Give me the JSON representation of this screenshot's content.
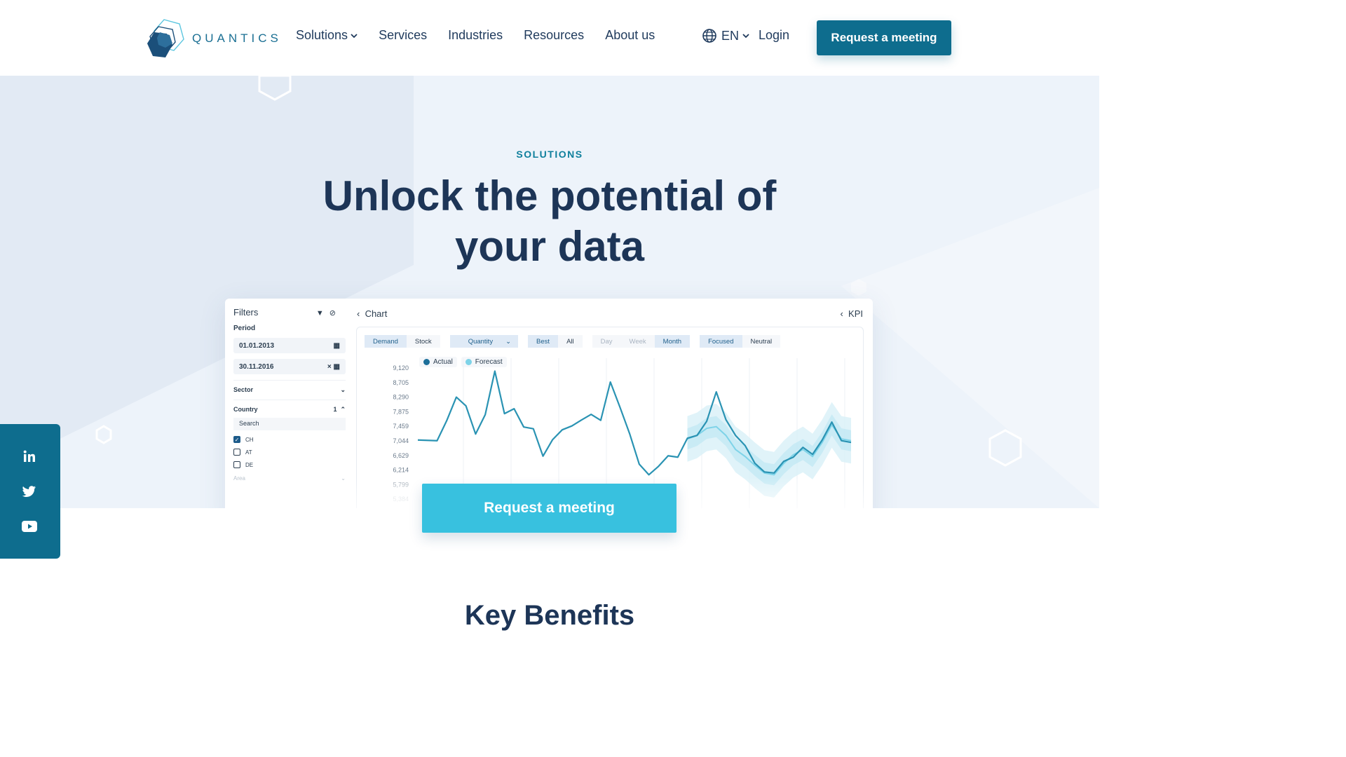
{
  "brand": {
    "name": "QUANTICS",
    "accent": "#0e6d8e",
    "cta_light": "#38c1df",
    "headline_color": "#1d3557"
  },
  "nav": {
    "items": [
      {
        "label": "Solutions",
        "has_dropdown": true
      },
      {
        "label": "Services"
      },
      {
        "label": "Industries"
      },
      {
        "label": "Resources"
      },
      {
        "label": "About us"
      }
    ],
    "language": "EN",
    "login": "Login",
    "cta": "Request a meeting"
  },
  "hero": {
    "eyebrow": "SOLUTIONS",
    "headline_line1": "Unlock the potential of",
    "headline_line2": "your data",
    "cta": "Request a meeting"
  },
  "dashboard": {
    "filters": {
      "title": "Filters",
      "period_label": "Period",
      "date_from": "01.01.2013",
      "date_to": "30.11.2016",
      "sector_label": "Sector",
      "country_label": "Country",
      "country_count": "1",
      "search_placeholder": "Search",
      "countries": [
        {
          "code": "CH",
          "checked": true
        },
        {
          "code": "AT",
          "checked": false
        },
        {
          "code": "DE",
          "checked": false
        }
      ],
      "area_label": "Area"
    },
    "chart_title": "Chart",
    "kpi_title": "KPI",
    "toolbar": {
      "measure": [
        "Demand",
        "Stock"
      ],
      "quantity": "Quantity",
      "scope": [
        "Best",
        "All"
      ],
      "granularity": [
        "Day",
        "Week",
        "Month"
      ],
      "mode": [
        "Focused",
        "Neutral"
      ]
    },
    "legend": {
      "actual": "Actual",
      "forecast": "Forecast"
    }
  },
  "chart_data": {
    "type": "line",
    "yticks": [
      "9,120",
      "8,705",
      "8,290",
      "7,875",
      "7,459",
      "7,044",
      "6,629",
      "6,214",
      "5,799",
      "5,384"
    ],
    "series": [
      {
        "name": "Actual",
        "color": "#2a93b3",
        "values": [
          7070,
          7060,
          7050,
          7620,
          8290,
          8040,
          7240,
          7790,
          9030,
          7820,
          7960,
          7440,
          7390,
          6610,
          7080,
          7360,
          7470,
          7640,
          7800,
          7630,
          8720,
          8000,
          7250,
          6380,
          6080,
          6320,
          6620,
          6580,
          7120,
          7200,
          7600,
          8440,
          7650,
          7200,
          6910,
          6410,
          6160,
          6130,
          6460,
          6580,
          6860,
          6660,
          7070,
          7580,
          7050,
          7000
        ]
      },
      {
        "name": "Forecast",
        "color": "#7ed3e8",
        "values": [
          7100,
          7200,
          7400,
          7450,
          7200,
          6800,
          6600,
          6350,
          6130,
          6080,
          6400,
          6650,
          6800,
          6600,
          7000,
          7500,
          7100,
          7050
        ]
      }
    ]
  },
  "social": [
    "linkedin-icon",
    "twitter-icon",
    "youtube-icon"
  ],
  "benefits_title": "Key Benefits"
}
